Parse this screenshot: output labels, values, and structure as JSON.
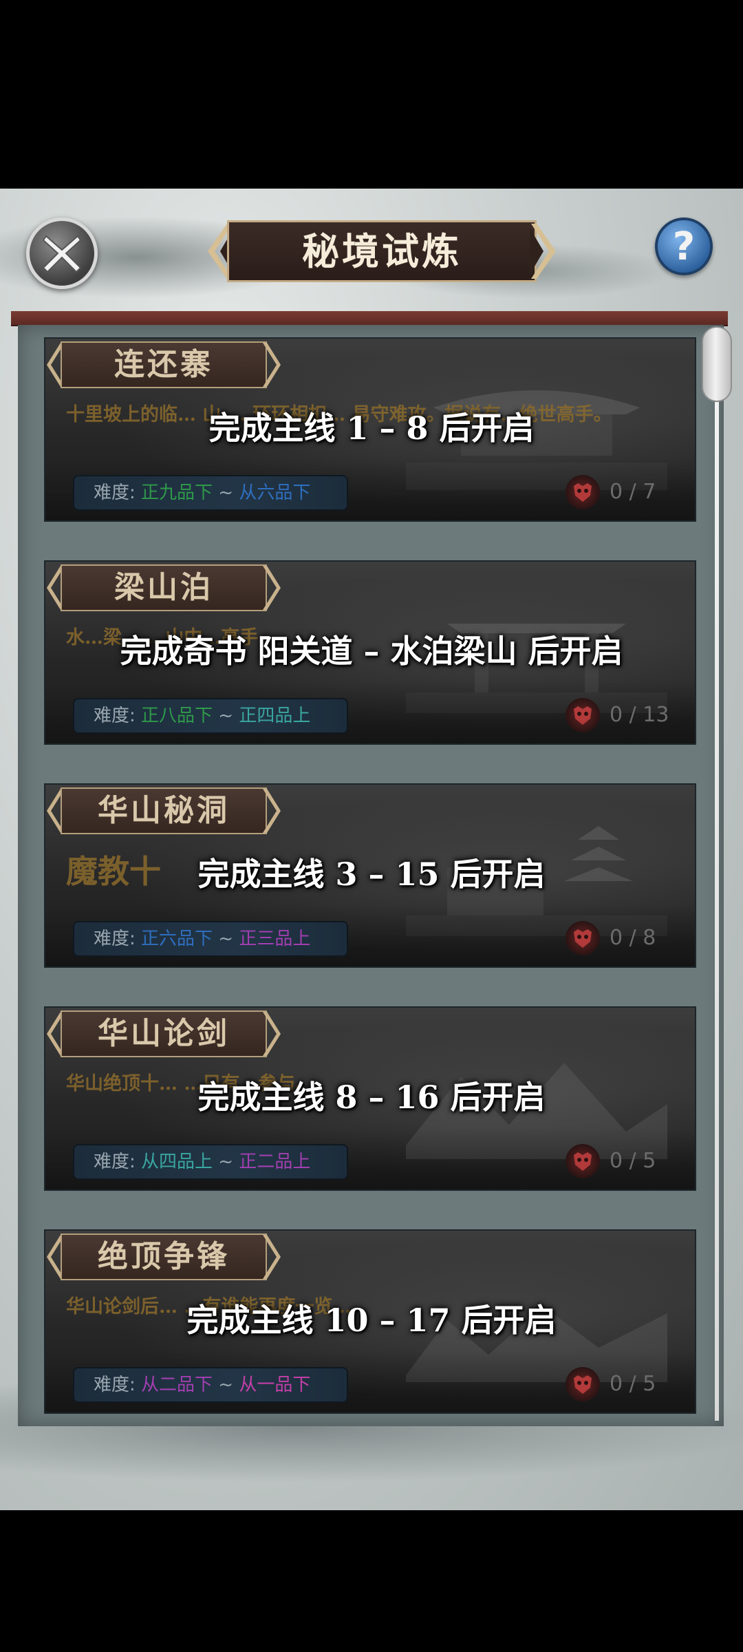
{
  "header": {
    "title": "秘境试炼"
  },
  "colors": {
    "green": "#2f9a4a",
    "teal": "#3aa6a0",
    "blue": "#2f6fbf",
    "purple": "#a23fb0",
    "pink": "#c23fa8"
  },
  "cards": [
    {
      "name": "连还寨",
      "desc": "十里坡上的临… 山 … 环环相扣… 易守难攻。据说有…绝世高手。",
      "difficulty_label": "难度:",
      "diff_from": "正九品下",
      "diff_sep": " ~ ",
      "diff_to": "从六品下",
      "progress": "0 / 7",
      "lock_text": "完成主线 1 – 8 后开启"
    },
    {
      "name": "梁山泊",
      "desc": "水…梁…  …山中…高手",
      "difficulty_label": "难度:",
      "diff_from": "正八品下",
      "diff_sep": " ~ ",
      "diff_to": "正四品上",
      "progress": "0 / 13",
      "lock_text": "完成奇书 阳关道 – 水泊梁山 后开启"
    },
    {
      "name": "华山秘洞",
      "desc": "魔教十",
      "difficulty_label": "难度:",
      "diff_from": "正六品下",
      "diff_sep": " ~ ",
      "diff_to": "正三品上",
      "progress": "0 / 8",
      "lock_text": "完成主线 3 – 15 后开启"
    },
    {
      "name": "华山论剑",
      "desc": "华山绝顶十…  …只有…参与。",
      "difficulty_label": "难度:",
      "diff_from": "从四品上",
      "diff_sep": " ~ ",
      "diff_to": "正二品上",
      "progress": "0 / 5",
      "lock_text": "完成主线 8 – 16 后开启"
    },
    {
      "name": "绝顶争锋",
      "desc": "华山论剑后…  …有谁能再度一览…",
      "difficulty_label": "难度:",
      "diff_from": "从二品下",
      "diff_sep": " ~ ",
      "diff_to": "从一品下",
      "progress": "0 / 5",
      "lock_text": "完成主线 10 – 17 后开启"
    }
  ]
}
